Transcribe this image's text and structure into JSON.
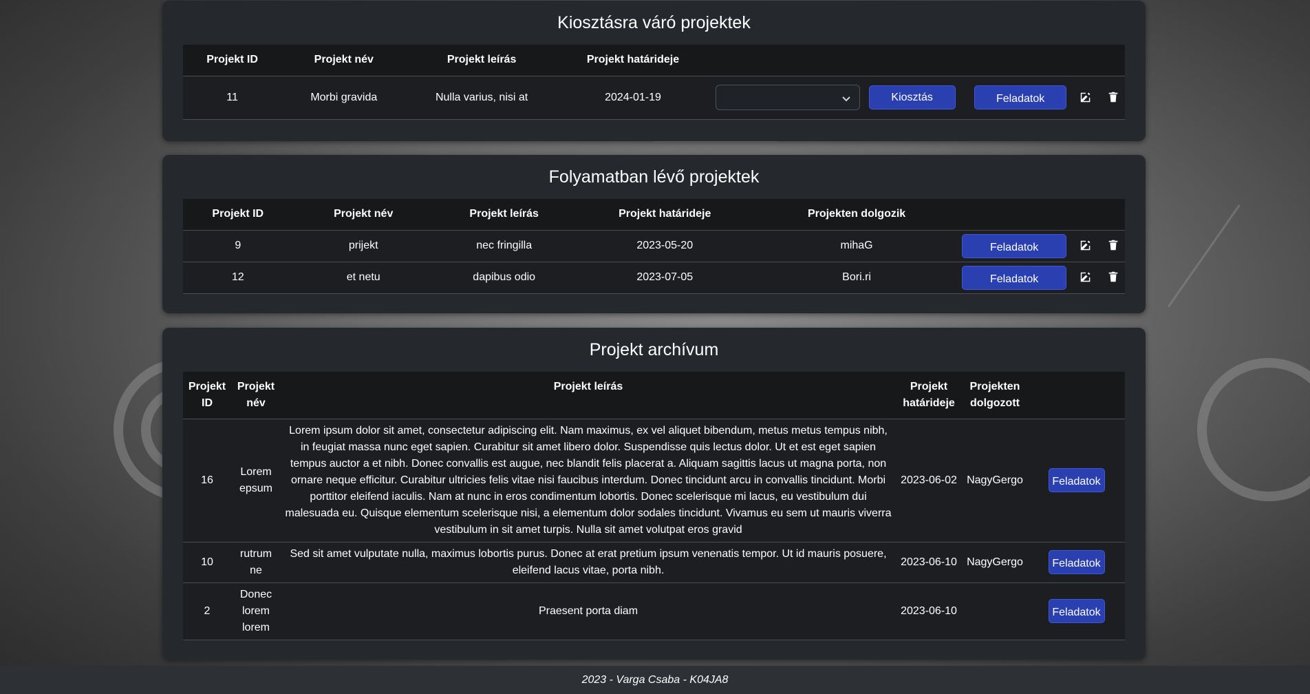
{
  "pending": {
    "title": "Kiosztásra váró projektek",
    "headers": [
      "Projekt ID",
      "Projekt név",
      "Projekt leírás",
      "Projekt határideje"
    ],
    "rows": [
      {
        "id": "11",
        "name": "Morbi gravida",
        "desc": "Nulla varius, nisi at",
        "deadline": "2024-01-19"
      }
    ],
    "select_value": "",
    "assign_label": "Kiosztás",
    "tasks_label": "Feladatok"
  },
  "in_progress": {
    "title": "Folyamatban lévő projektek",
    "headers": [
      "Projekt ID",
      "Projekt név",
      "Projekt leírás",
      "Projekt határideje",
      "Projekten dolgozik"
    ],
    "rows": [
      {
        "id": "9",
        "name": "prijekt",
        "desc": "nec fringilla",
        "deadline": "2023-05-20",
        "worker": "mihaG"
      },
      {
        "id": "12",
        "name": "et netu",
        "desc": "dapibus odio",
        "deadline": "2023-07-05",
        "worker": "Bori.ri"
      }
    ],
    "tasks_label": "Feladatok"
  },
  "archive": {
    "title": "Projekt archívum",
    "headers": [
      "Projekt ID",
      "Projekt név",
      "Projekt leírás",
      "Projekt határideje",
      "Projekten dolgozott"
    ],
    "rows": [
      {
        "id": "16",
        "name": "Lorem epsum",
        "desc": "Lorem ipsum dolor sit amet, consectetur adipiscing elit. Nam maximus, ex vel aliquet bibendum, metus metus tempus nibh, in feugiat massa nunc eget sapien. Curabitur sit amet libero dolor. Suspendisse quis lectus dolor. Ut et est eget sapien tempus auctor a et nibh. Donec convallis est augue, nec blandit felis placerat a. Aliquam sagittis lacus ut magna porta, non ornare neque efficitur. Curabitur ultricies felis vitae nisi faucibus interdum. Donec tincidunt arcu in convallis tincidunt. Morbi porttitor eleifend iaculis. Nam at nunc in eros condimentum lobortis. Donec scelerisque mi lacus, eu vestibulum dui malesuada eu. Quisque elementum scelerisque nisi, a elementum dolor sodales tincidunt. Vivamus eu sem ut mauris viverra vestibulum in sit amet turpis. Nulla sit amet volutpat eros gravid",
        "deadline": "2023-06-02",
        "worker": "NagyGergo"
      },
      {
        "id": "10",
        "name": "rutrum ne",
        "desc": "Sed sit amet vulputate nulla, maximus lobortis purus. Donec at erat pretium ipsum venenatis tempor. Ut id mauris posuere, eleifend lacus vitae, porta nibh.",
        "deadline": "2023-06-10",
        "worker": "NagyGergo"
      },
      {
        "id": "2",
        "name": "Donec lorem lorem",
        "desc": "Praesent porta diam",
        "deadline": "2023-06-10",
        "worker": ""
      }
    ],
    "tasks_label": "Feladatok"
  },
  "footer": {
    "text": "2023 - Varga Csaba - K04JA8"
  },
  "colors": {
    "panel": "#25292e",
    "button": "#2a3fb0",
    "table": "#1c1e21"
  }
}
